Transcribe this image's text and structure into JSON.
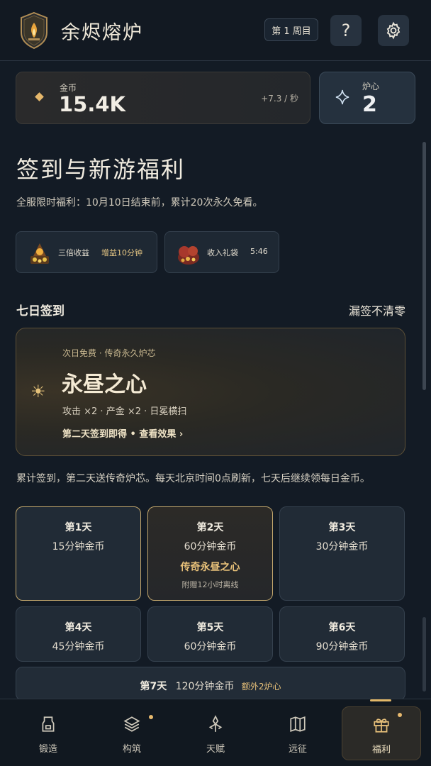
{
  "app": {
    "title": "余烬熔炉",
    "cycle_label": "第 1 周目"
  },
  "header": {
    "help_label": "?"
  },
  "currency": {
    "gold": {
      "label": "金币",
      "value": "15.4K",
      "rate": "+7.3 / 秒"
    },
    "core": {
      "label": "炉心",
      "value": "2"
    }
  },
  "welfare": {
    "title": "签到与新游福利",
    "subtitle": "全服限时福利：10月10日结束前，累计20次永久免看。",
    "promos": [
      {
        "name": "三倍收益",
        "tag": "增益10分钟"
      },
      {
        "name": "收入礼袋",
        "tag": "5:46"
      }
    ]
  },
  "signin": {
    "heading": "七日签到",
    "note": "漏签不清零",
    "hero": {
      "kicker": "次日免费 · 传奇永久炉芯",
      "title": "永昼之心",
      "stats": "攻击 ×2 · 产金 ×2 · 日冕横扫",
      "link": "第二天签到即得 • 查看效果 ›"
    },
    "description": "累计签到，第二天送传奇炉芯。每天北京时间0点刷新，七天后继续领每日金币。",
    "days": [
      {
        "title": "第1天",
        "reward": "15分钟金币"
      },
      {
        "title": "第2天",
        "reward": "60分钟金币",
        "extra": "传奇永昼之心",
        "note": "附赠12小时离线"
      },
      {
        "title": "第3天",
        "reward": "30分钟金币"
      },
      {
        "title": "第4天",
        "reward": "45分钟金币"
      },
      {
        "title": "第5天",
        "reward": "60分钟金币"
      },
      {
        "title": "第6天",
        "reward": "90分钟金币"
      }
    ],
    "day7": {
      "title": "第7天",
      "reward": "120分钟金币",
      "bonus": "额外2炉心"
    }
  },
  "nav": {
    "items": [
      {
        "label": "锻造",
        "icon": "anvil-icon"
      },
      {
        "label": "构筑",
        "icon": "layers-icon"
      },
      {
        "label": "天赋",
        "icon": "talent-icon"
      },
      {
        "label": "远征",
        "icon": "map-icon"
      },
      {
        "label": "福利",
        "icon": "gift-icon"
      }
    ]
  },
  "colors": {
    "accent": "#c2a66c",
    "gold": "#e9c27a",
    "background": "#131b25"
  }
}
